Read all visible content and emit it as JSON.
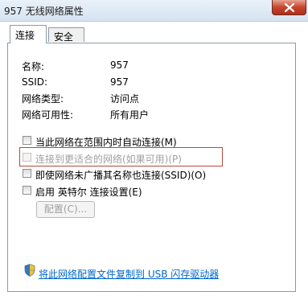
{
  "window": {
    "title": "957 无线网络属性"
  },
  "tabs": [
    {
      "label": "连接",
      "active": true
    },
    {
      "label": "安全",
      "active": false
    }
  ],
  "info": [
    {
      "label": "名称:",
      "value": "957"
    },
    {
      "label": "SSID:",
      "value": "957"
    },
    {
      "label": "网络类型:",
      "value": "访问点"
    },
    {
      "label": "网络可用性:",
      "value": "所有用户"
    }
  ],
  "options": [
    {
      "label": "当此网络在范围内时自动连接(M)",
      "checked": false,
      "enabled": true
    },
    {
      "label": "连接到更适合的网络(如果可用)(P)",
      "checked": false,
      "enabled": false
    },
    {
      "label": "即使网络未广播其名称也连接(SSID)(O)",
      "checked": false,
      "enabled": true
    },
    {
      "label": "启用 英特尔 连接设置(E)",
      "checked": false,
      "enabled": true
    }
  ],
  "config_button": "配置(C)...",
  "footer_link": "将此网络配置文件复制到 USB 闪存驱动器",
  "icons": {
    "close": "close-icon",
    "shield": "uac-shield-icon"
  },
  "colors": {
    "link": "#0066cc",
    "highlight": "#b24a3c",
    "close": "#c7452d"
  }
}
